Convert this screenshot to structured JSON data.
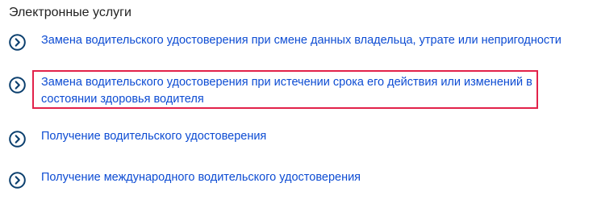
{
  "section": {
    "title": "Электронные услуги"
  },
  "icons": {
    "service_icon": "chevron-right-circle-icon",
    "accent_color": "#0d4cd3",
    "highlight_color": "#e2224a"
  },
  "services": [
    {
      "label": "Замена водительского удостоверения при смене данных владельца, утрате или непригодности"
    },
    {
      "label": "Замена водительского удостоверения при истечении срока его действия или изменений в состоянии здоровья водителя",
      "highlighted": true
    },
    {
      "label": "Получение водительского удостоверения"
    },
    {
      "label": "Получение международного водительского удостоверения"
    }
  ]
}
